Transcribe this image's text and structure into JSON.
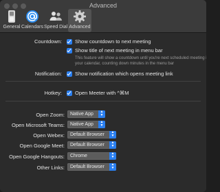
{
  "window": {
    "title": "Advanced"
  },
  "toolbar": {
    "tabs": [
      {
        "label": "General",
        "icon": "switch-icon"
      },
      {
        "label": "Calendars",
        "icon": "at-sign-icon"
      },
      {
        "label": "Speed Dial",
        "icon": "people-icon"
      },
      {
        "label": "Advanced",
        "icon": "gear-icon",
        "selected": true
      }
    ]
  },
  "countdown": {
    "label": "Countdown:",
    "show_countdown": {
      "label": "Show countdown to next meeting",
      "checked": true
    },
    "show_title": {
      "label": "Show title of next meeting in menu bar",
      "checked": true
    },
    "hint": "This feature will show a countdown until you're next scheduled meeting in your calendar, counting down minutes in the menu bar"
  },
  "notification": {
    "label": "Notification:",
    "show_notification": {
      "label": "Show notification which opens meeting link",
      "checked": true
    }
  },
  "hotkey": {
    "label": "Hotkey:",
    "open_meeter": {
      "label": "Open Meeter with ^⌘M",
      "checked": true
    }
  },
  "open_settings": [
    {
      "label": "Open Zoom:",
      "value": "Native App"
    },
    {
      "label": "Open Microsoft Teams:",
      "value": "Native App"
    },
    {
      "label": "Open Webex:",
      "value": "Default Browser"
    },
    {
      "label": "Open Google Meet:",
      "value": "Default Browser"
    },
    {
      "label": "Open Google Hangouts:",
      "value": "Chrome"
    },
    {
      "label": "Other Links:",
      "value": "Default Browser"
    }
  ],
  "colors": {
    "accent": "#2a7ff0",
    "background": "#2b2b2b",
    "text": "#e6e6e6"
  }
}
